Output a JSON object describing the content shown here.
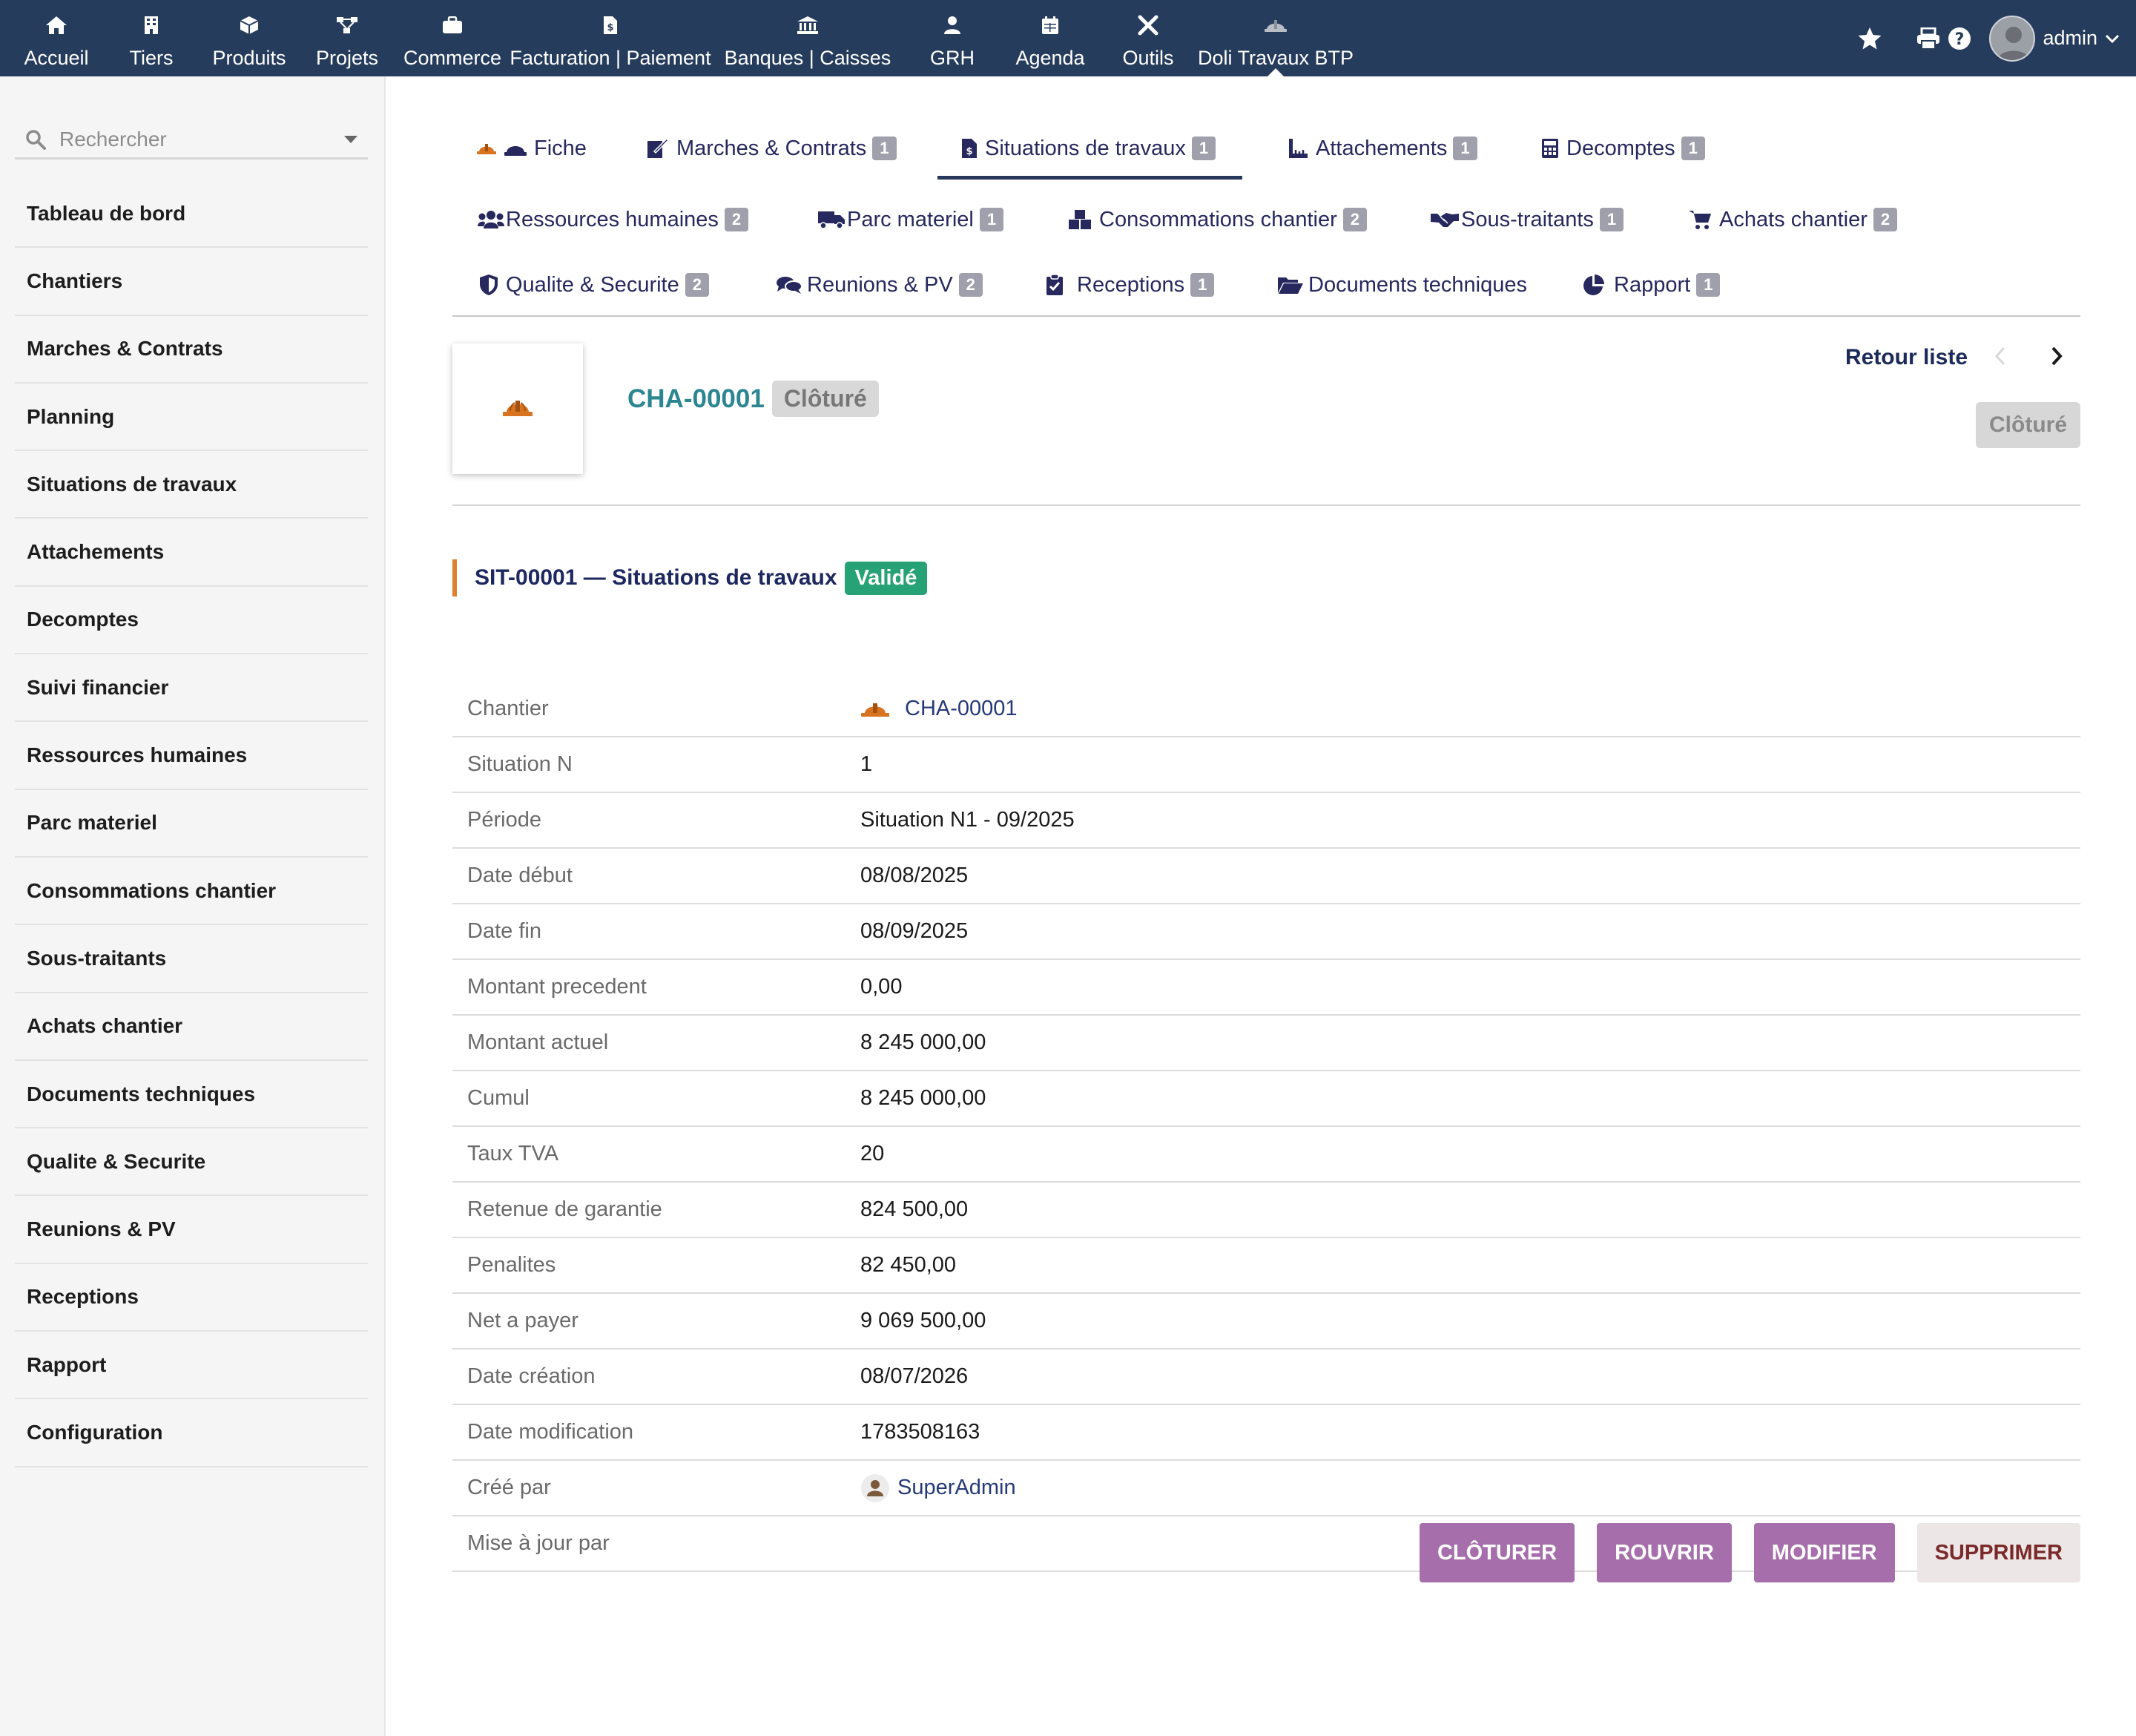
{
  "topmenu": {
    "items": [
      {
        "label": "Accueil",
        "icon": "home-icon"
      },
      {
        "label": "Tiers",
        "icon": "building-icon"
      },
      {
        "label": "Produits",
        "icon": "cube-icon"
      },
      {
        "label": "Projets",
        "icon": "project-icon"
      },
      {
        "label": "Commerce",
        "icon": "suitcase-icon"
      },
      {
        "label": "Facturation | Paiement",
        "icon": "invoice-icon"
      },
      {
        "label": "Banques | Caisses",
        "icon": "bank-icon"
      },
      {
        "label": "GRH",
        "icon": "user-tie-icon"
      },
      {
        "label": "Agenda",
        "icon": "calendar-icon"
      },
      {
        "label": "Outils",
        "icon": "tools-icon"
      },
      {
        "label": "Doli Travaux BTP",
        "icon": "hardhat-icon"
      }
    ],
    "user": "admin"
  },
  "sidebar": {
    "search_placeholder": "Rechercher",
    "items": [
      "Tableau de bord",
      "Chantiers",
      "Marches & Contrats",
      "Planning",
      "Situations de travaux",
      "Attachements",
      "Decomptes",
      "Suivi financier",
      "Ressources humaines",
      "Parc materiel",
      "Consommations chantier",
      "Sous-traitants",
      "Achats chantier",
      "Documents techniques",
      "Qualite & Securite",
      "Reunions & PV",
      "Receptions",
      "Rapport",
      "Configuration"
    ]
  },
  "tabs": {
    "fiche": {
      "label": "Fiche"
    },
    "marches": {
      "label": "Marches & Contrats",
      "badge": "1"
    },
    "situations": {
      "label": "Situations de travaux",
      "badge": "1"
    },
    "attachements": {
      "label": "Attachements",
      "badge": "1"
    },
    "decomptes": {
      "label": "Decomptes",
      "badge": "1"
    },
    "rh": {
      "label": "Ressources humaines",
      "badge": "2"
    },
    "parc": {
      "label": "Parc materiel",
      "badge": "1"
    },
    "conso": {
      "label": "Consommations chantier",
      "badge": "2"
    },
    "soustraitants": {
      "label": "Sous-traitants",
      "badge": "1"
    },
    "achats": {
      "label": "Achats chantier",
      "badge": "2"
    },
    "qualite": {
      "label": "Qualite & Securite",
      "badge": "2"
    },
    "reunions": {
      "label": "Reunions & PV",
      "badge": "2"
    },
    "receptions": {
      "label": "Receptions",
      "badge": "1"
    },
    "documents": {
      "label": "Documents techniques"
    },
    "rapport": {
      "label": "Rapport",
      "badge": "1"
    }
  },
  "header": {
    "ref": "CHA-00001",
    "status": "Clôturé",
    "retour": "Retour liste",
    "status_button": "Clôturé"
  },
  "section": {
    "title": "SIT-00001 — Situations de travaux",
    "status": "Validé"
  },
  "fields": [
    {
      "label": "Chantier",
      "value": "CHA-00001"
    },
    {
      "label": "Situation N",
      "value": "1"
    },
    {
      "label": "Période",
      "value": "Situation N1 - 09/2025"
    },
    {
      "label": "Date début",
      "value": "08/08/2025"
    },
    {
      "label": "Date fin",
      "value": "08/09/2025"
    },
    {
      "label": "Montant precedent",
      "value": "0,00"
    },
    {
      "label": "Montant actuel",
      "value": "8 245 000,00"
    },
    {
      "label": "Cumul",
      "value": "8 245 000,00"
    },
    {
      "label": "Taux TVA",
      "value": "20"
    },
    {
      "label": "Retenue de garantie",
      "value": "824 500,00"
    },
    {
      "label": "Penalites",
      "value": "82 450,00"
    },
    {
      "label": "Net a payer",
      "value": "9 069 500,00"
    },
    {
      "label": "Date création",
      "value": "08/07/2026"
    },
    {
      "label": "Date modification",
      "value": "1783508163"
    },
    {
      "label": "Créé par",
      "value": "SuperAdmin"
    },
    {
      "label": "Mise à jour par",
      "value": ""
    }
  ],
  "actions": {
    "cloturer": "CLÔTURER",
    "rouvrir": "ROUVRIR",
    "modifier": "MODIFIER",
    "supprimer": "SUPPRIMER"
  },
  "colors": {
    "topbar": "#263c5c",
    "accent_teal": "#2b8691",
    "status_green": "#27a176",
    "button_purple": "#a66fab",
    "section_accent": "#e07f2d"
  }
}
